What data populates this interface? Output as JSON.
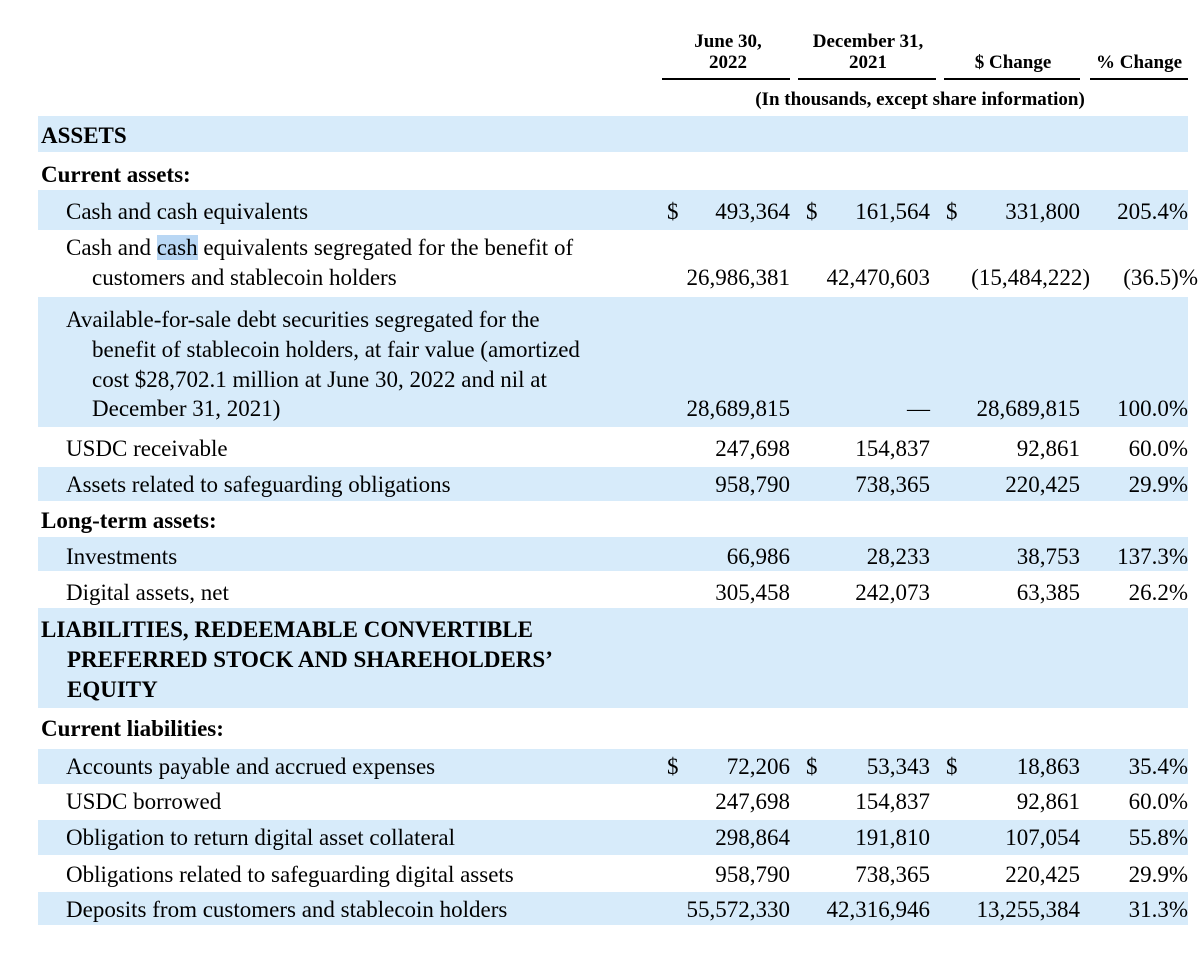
{
  "header": {
    "col1": [
      "June 30,",
      "2022"
    ],
    "col2": [
      "December 31,",
      "2021"
    ],
    "col3": "$ Change",
    "col4": "% Change",
    "units": "(In thousands, except share information)"
  },
  "sections": {
    "assets": "ASSETS",
    "current_assets": "Current assets:",
    "long_term_assets": "Long-term assets:",
    "liabilities": [
      "LIABILITIES, REDEEMABLE CONVERTIBLE",
      "PREFERRED STOCK AND SHAREHOLDERS’",
      "EQUITY"
    ],
    "current_liabilities": "Current liabilities:"
  },
  "currency": "$",
  "rows": {
    "cash": {
      "label": "Cash and cash equivalents",
      "v1": "493,364",
      "v2": "161,564",
      "v3": "331,800",
      "v4": "205.4%"
    },
    "cash_seg": {
      "label_a": "Cash and ",
      "label_sel": "cash",
      "label_b": " equivalents segregated for the benefit of",
      "label2": "customers and stablecoin holders",
      "v1": "26,986,381",
      "v2": "42,470,603",
      "v3": "(15,484,222)",
      "v4": "(36.5)%"
    },
    "afs": {
      "lines": [
        "Available-for-sale debt securities segregated for the",
        "benefit of stablecoin holders, at fair value (amortized",
        "cost $28,702.1 million at June 30, 2022 and nil at",
        "December 31, 2021)"
      ],
      "v1": "28,689,815",
      "v2": "—",
      "v3": "28,689,815",
      "v4": "100.0%"
    },
    "usdc_rec": {
      "label": "USDC receivable",
      "v1": "247,698",
      "v2": "154,837",
      "v3": "92,861",
      "v4": "60.0%"
    },
    "safeguard_assets": {
      "label": "Assets related to safeguarding obligations",
      "v1": "958,790",
      "v2": "738,365",
      "v3": "220,425",
      "v4": "29.9%"
    },
    "investments": {
      "label": "Investments",
      "v1": "66,986",
      "v2": "28,233",
      "v3": "38,753",
      "v4": "137.3%"
    },
    "digital_assets": {
      "label": "Digital assets, net",
      "v1": "305,458",
      "v2": "242,073",
      "v3": "63,385",
      "v4": "26.2%"
    },
    "accounts_payable": {
      "label": "Accounts payable and accrued expenses",
      "v1": "72,206",
      "v2": "53,343",
      "v3": "18,863",
      "v4": "35.4%"
    },
    "usdc_borrowed": {
      "label": "USDC borrowed",
      "v1": "247,698",
      "v2": "154,837",
      "v3": "92,861",
      "v4": "60.0%"
    },
    "collateral": {
      "label": "Obligation to return digital asset collateral",
      "v1": "298,864",
      "v2": "191,810",
      "v3": "107,054",
      "v4": "55.8%"
    },
    "safeguard_obl": {
      "label": "Obligations related to safeguarding digital assets",
      "v1": "958,790",
      "v2": "738,365",
      "v3": "220,425",
      "v4": "29.9%"
    },
    "deposits": {
      "label": "Deposits from customers and stablecoin holders",
      "v1": "55,572,330",
      "v2": "42,316,946",
      "v3": "13,255,384",
      "v4": "31.3%"
    }
  }
}
